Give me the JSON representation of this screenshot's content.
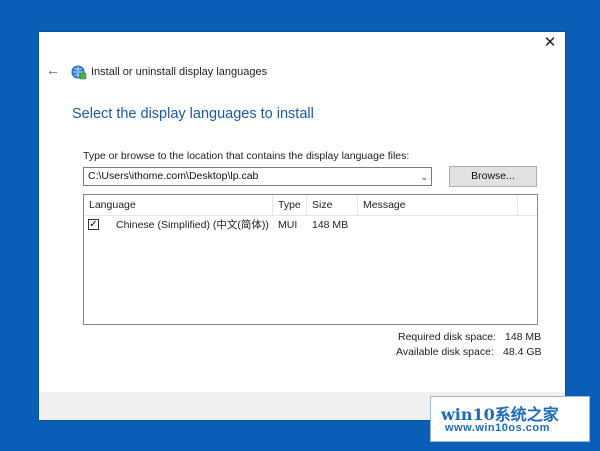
{
  "window": {
    "title": "Install or uninstall display languages",
    "close_glyph": "✕",
    "back_glyph": "←"
  },
  "page": {
    "heading": "Select the display languages to install",
    "path_label": "Type or browse to the location that contains the display language files:",
    "path_value": "C:\\Users\\ithome.com\\Desktop\\lp.cab",
    "browse_label": "Browse..."
  },
  "list": {
    "columns": [
      "Language",
      "Type",
      "Size",
      "Message"
    ],
    "rows": [
      {
        "checked": true,
        "language": "Chinese (Simplified) (中文(简体))",
        "type": "MUI",
        "size": "148 MB",
        "message": ""
      }
    ]
  },
  "disk": {
    "required_label": "Required disk space:",
    "required_value": "148 MB",
    "available_label": "Available disk space:",
    "available_value": "48.4 GB"
  },
  "watermark": {
    "title": "win10系统之家",
    "url": "www.win10os.com"
  },
  "colors": {
    "desktop": "#0a5eb5",
    "heading": "#1c5aa8",
    "watermark": "#1b6bb8"
  },
  "icons": [
    "close-icon",
    "back-arrow-icon",
    "globe-icon",
    "chevron-down-icon",
    "checkmark-icon"
  ]
}
